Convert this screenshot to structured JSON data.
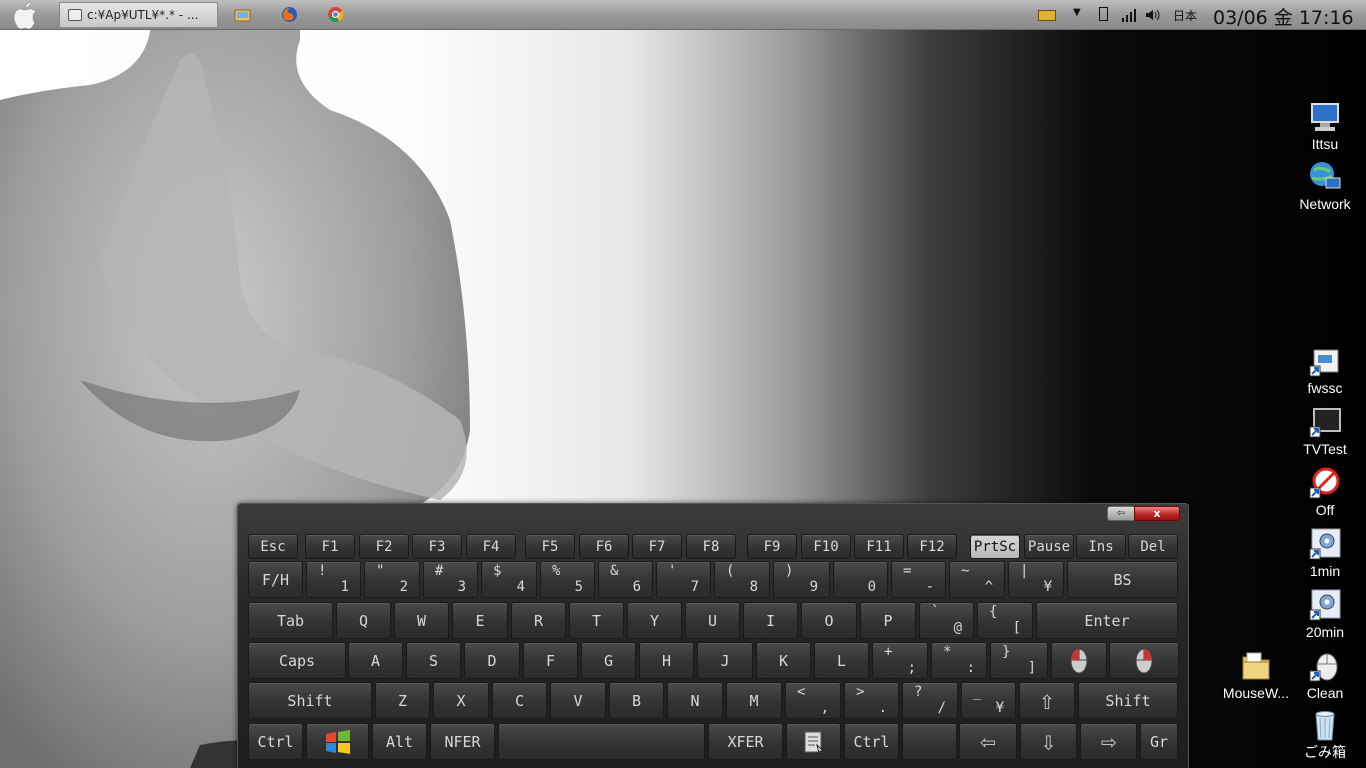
{
  "taskbar": {
    "active_window_title": "c:¥Ap¥UTL¥*.* - ...",
    "language": "日本",
    "clock": "03/06 金 17:16"
  },
  "desktop_icons": [
    {
      "label": "Ittsu",
      "icon": "computer-icon"
    },
    {
      "label": "Network",
      "icon": "network-icon"
    },
    {
      "label": "fwssc",
      "icon": "shortcut-icon"
    },
    {
      "label": "TVTest",
      "icon": "tv-icon"
    },
    {
      "label": "Off",
      "icon": "power-off-icon"
    },
    {
      "label": "1min",
      "icon": "gear-shortcut-icon"
    },
    {
      "label": "20min",
      "icon": "gear-shortcut-icon"
    },
    {
      "label": "MouseW...",
      "icon": "folder-icon"
    },
    {
      "label": "Clean",
      "icon": "mouse-icon"
    },
    {
      "label": "ごみ箱",
      "icon": "recycle-bin-icon"
    }
  ],
  "osk": {
    "minimize_label": "⇦",
    "close_label": "x",
    "rows": [
      [
        {
          "t": "Esc"
        },
        {
          "t": "F1"
        },
        {
          "t": "F2"
        },
        {
          "t": "F3"
        },
        {
          "t": "F4"
        },
        {
          "t": "F5"
        },
        {
          "t": "F6"
        },
        {
          "t": "F7"
        },
        {
          "t": "F8"
        },
        {
          "t": "F9"
        },
        {
          "t": "F10"
        },
        {
          "t": "F11"
        },
        {
          "t": "F12"
        },
        {
          "t": "PrtSc",
          "on": true
        },
        {
          "t": "Pause"
        },
        {
          "t": "Ins"
        },
        {
          "t": "Del"
        }
      ],
      [
        {
          "t": "F/H"
        },
        {
          "s": "!",
          "b": "1"
        },
        {
          "s": "\"",
          "b": "2"
        },
        {
          "s": "#",
          "b": "3"
        },
        {
          "s": "$",
          "b": "4"
        },
        {
          "s": "%",
          "b": "5"
        },
        {
          "s": "&",
          "b": "6"
        },
        {
          "s": "'",
          "b": "7"
        },
        {
          "s": "(",
          "b": "8"
        },
        {
          "s": ")",
          "b": "9"
        },
        {
          "s": "",
          "b": "0"
        },
        {
          "s": "=",
          "b": "-"
        },
        {
          "s": "~",
          "b": "^"
        },
        {
          "s": "|",
          "b": "¥"
        },
        {
          "t": "BS"
        }
      ],
      [
        {
          "t": "Tab"
        },
        {
          "t": "Q"
        },
        {
          "t": "W"
        },
        {
          "t": "E"
        },
        {
          "t": "R"
        },
        {
          "t": "T"
        },
        {
          "t": "Y"
        },
        {
          "t": "U"
        },
        {
          "t": "I"
        },
        {
          "t": "O"
        },
        {
          "t": "P"
        },
        {
          "s": "`",
          "b": "@"
        },
        {
          "s": "{",
          "b": "["
        },
        {
          "t": "Enter"
        }
      ],
      [
        {
          "t": "Caps"
        },
        {
          "t": "A"
        },
        {
          "t": "S"
        },
        {
          "t": "D"
        },
        {
          "t": "F"
        },
        {
          "t": "G"
        },
        {
          "t": "H"
        },
        {
          "t": "J"
        },
        {
          "t": "K"
        },
        {
          "t": "L"
        },
        {
          "s": "+",
          "b": ";"
        },
        {
          "s": "*",
          "b": ":"
        },
        {
          "s": "}",
          "b": "]"
        },
        {
          "icon": "mouse-left-icon"
        },
        {
          "icon": "mouse-right-icon"
        }
      ],
      [
        {
          "t": "Shift"
        },
        {
          "t": "Z"
        },
        {
          "t": "X"
        },
        {
          "t": "C"
        },
        {
          "t": "V"
        },
        {
          "t": "B"
        },
        {
          "t": "N"
        },
        {
          "t": "M"
        },
        {
          "s": "<",
          "b": ","
        },
        {
          "s": ">",
          "b": "."
        },
        {
          "s": "?",
          "b": "/"
        },
        {
          "s": "_",
          "b": "¥"
        },
        {
          "icon": "arrow-up-icon",
          "t": "⇧"
        },
        {
          "t": "Shift"
        }
      ],
      [
        {
          "t": "Ctrl"
        },
        {
          "icon": "windows-logo-icon"
        },
        {
          "t": "Alt"
        },
        {
          "t": "NFER"
        },
        {
          "t": ""
        },
        {
          "t": "XFER"
        },
        {
          "icon": "menu-key-icon"
        },
        {
          "t": "Ctrl"
        },
        {
          "t": ""
        },
        {
          "icon": "arrow-left-icon",
          "t": "⇦"
        },
        {
          "icon": "arrow-down-icon",
          "t": "⇩"
        },
        {
          "icon": "arrow-right-icon",
          "t": "⇨"
        },
        {
          "t": "Gr"
        }
      ]
    ]
  }
}
